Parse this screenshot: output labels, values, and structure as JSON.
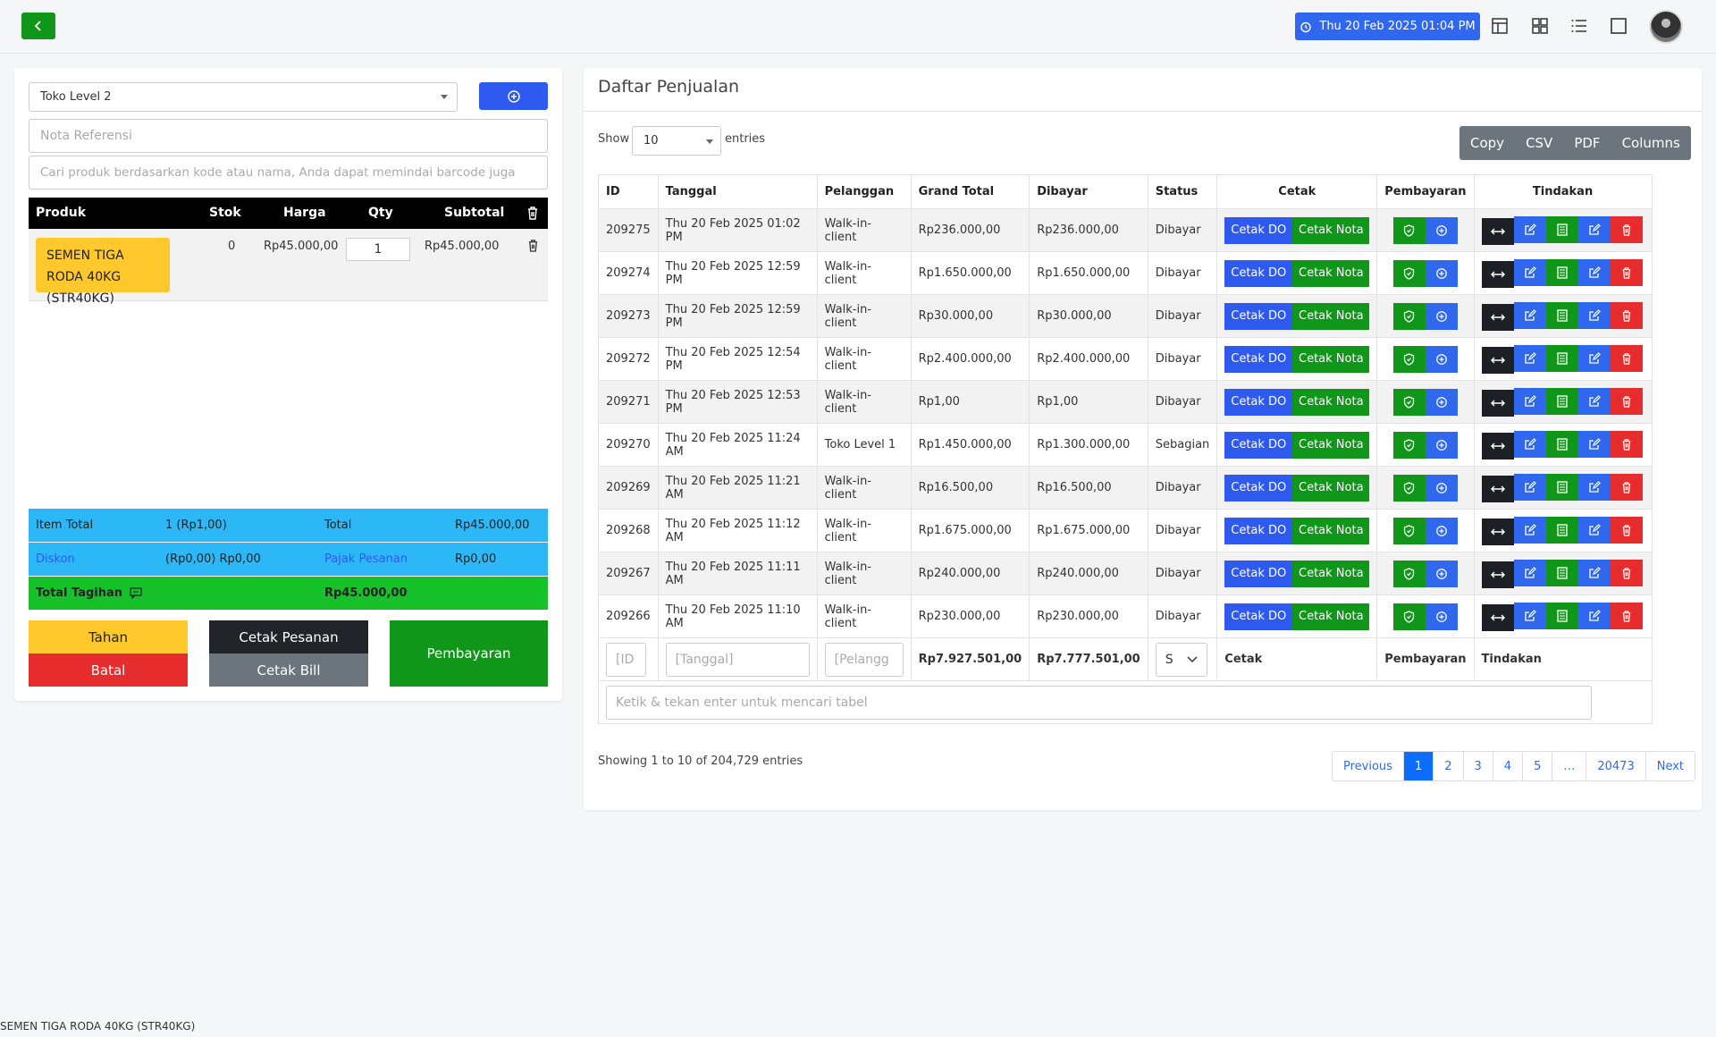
{
  "topbar": {
    "datetime": "Thu 20 Feb 2025 01:04 PM"
  },
  "left": {
    "customer_select": "Toko Level 2",
    "ref_placeholder": "Nota Referensi",
    "search_placeholder": "Cari produk berdasarkan kode atau nama, Anda dapat memindai barcode juga",
    "headers": {
      "product": "Produk",
      "stock": "Stok",
      "price": "Harga",
      "qty": "Qty",
      "subtotal": "Subtotal"
    },
    "item": {
      "name": "SEMEN TIGA RODA 40KG (STR40KG)",
      "stock": "0",
      "price": "Rp45.000,00",
      "qty": "1",
      "subtotal": "Rp45.000,00"
    },
    "summary": {
      "item_total_label": "Item Total",
      "item_total_value": "1 (Rp1,00)",
      "total_label": "Total",
      "total_value": "Rp45.000,00",
      "discount_label": "Diskon",
      "discount_value": "(Rp0,00) Rp0,00",
      "tax_label": "Pajak Pesanan",
      "tax_value": "Rp0,00",
      "bill_label": "Total Tagihan",
      "bill_value": "Rp45.000,00"
    },
    "buttons": {
      "hold": "Tahan",
      "cancel": "Batal",
      "print_order": "Cetak Pesanan",
      "print_bill": "Cetak Bill",
      "payment": "Pembayaran"
    },
    "colors": {
      "hold": "#ffc82c",
      "cancel": "#e62c2c",
      "print_order": "#212529",
      "print_bill": "#6c757d",
      "payment": "#109618"
    }
  },
  "right": {
    "title": "Daftar Penjualan",
    "show_label": "Show",
    "entries_label": "entries",
    "page_length": "10",
    "export": [
      "Copy",
      "CSV",
      "PDF",
      "Columns"
    ],
    "columns": [
      "ID",
      "Tanggal",
      "Pelanggan",
      "Grand Total",
      "Dibayar",
      "Status",
      "Cetak",
      "Pembayaran",
      "Tindakan"
    ],
    "print_do": "Cetak DO",
    "print_nota": "Cetak Nota",
    "rows": [
      {
        "id": "209275",
        "date": "Thu 20 Feb 2025 01:02 PM",
        "customer": "Walk-in-client",
        "grand_total": "Rp236.000,00",
        "paid": "Rp236.000,00",
        "status": "Dibayar"
      },
      {
        "id": "209274",
        "date": "Thu 20 Feb 2025 12:59 PM",
        "customer": "Walk-in-client",
        "grand_total": "Rp1.650.000,00",
        "paid": "Rp1.650.000,00",
        "status": "Dibayar"
      },
      {
        "id": "209273",
        "date": "Thu 20 Feb 2025 12:59 PM",
        "customer": "Walk-in-client",
        "grand_total": "Rp30.000,00",
        "paid": "Rp30.000,00",
        "status": "Dibayar"
      },
      {
        "id": "209272",
        "date": "Thu 20 Feb 2025 12:54 PM",
        "customer": "Walk-in-client",
        "grand_total": "Rp2.400.000,00",
        "paid": "Rp2.400.000,00",
        "status": "Dibayar"
      },
      {
        "id": "209271",
        "date": "Thu 20 Feb 2025 12:53 PM",
        "customer": "Walk-in-client",
        "grand_total": "Rp1,00",
        "paid": "Rp1,00",
        "status": "Dibayar"
      },
      {
        "id": "209270",
        "date": "Thu 20 Feb 2025 11:24 AM",
        "customer": "Toko Level 1",
        "grand_total": "Rp1.450.000,00",
        "paid": "Rp1.300.000,00",
        "status": "Sebagian"
      },
      {
        "id": "209269",
        "date": "Thu 20 Feb 2025 11:21 AM",
        "customer": "Walk-in-client",
        "grand_total": "Rp16.500,00",
        "paid": "Rp16.500,00",
        "status": "Dibayar"
      },
      {
        "id": "209268",
        "date": "Thu 20 Feb 2025 11:12 AM",
        "customer": "Walk-in-client",
        "grand_total": "Rp1.675.000,00",
        "paid": "Rp1.675.000,00",
        "status": "Dibayar"
      },
      {
        "id": "209267",
        "date": "Thu 20 Feb 2025 11:11 AM",
        "customer": "Walk-in-client",
        "grand_total": "Rp240.000,00",
        "paid": "Rp240.000,00",
        "status": "Dibayar"
      },
      {
        "id": "209266",
        "date": "Thu 20 Feb 2025 11:10 AM",
        "customer": "Walk-in-client",
        "grand_total": "Rp230.000,00",
        "paid": "Rp230.000,00",
        "status": "Dibayar"
      }
    ],
    "footer": {
      "id_placeholder": "[ID",
      "date_placeholder": "[Tanggal]",
      "customer_placeholder": "[Pelangg",
      "grand_total_sum": "Rp7.927.501,00",
      "paid_sum": "Rp7.777.501,00",
      "status_select": "S",
      "print": "Cetak",
      "payment": "Pembayaran",
      "action": "Tindakan"
    },
    "table_search_placeholder": "Ketik & tekan enter untuk mencari tabel",
    "info": "Showing 1 to 10 of 204,729 entries",
    "pagination": [
      "Previous",
      "1",
      "2",
      "3",
      "4",
      "5",
      "…",
      "20473",
      "Next"
    ],
    "active_page": "1"
  },
  "status_bar": "SEMEN TIGA RODA 40KG (STR40KG)"
}
